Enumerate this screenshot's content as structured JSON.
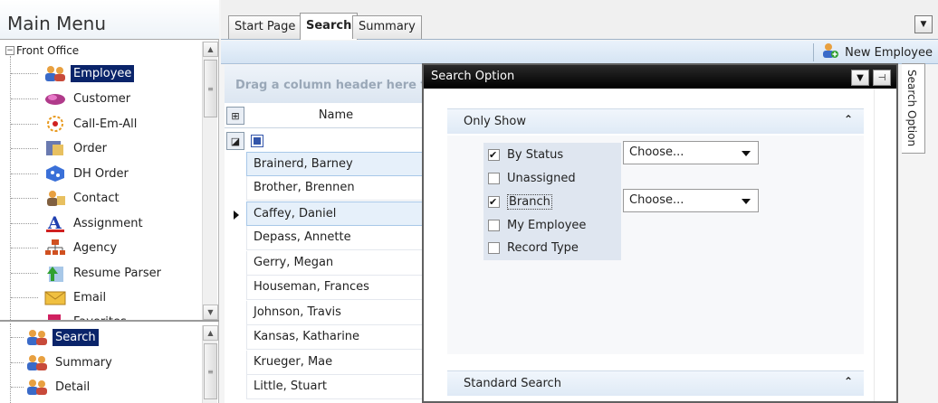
{
  "left_panel": {
    "title": "Main Menu",
    "root_label": "Front Office",
    "items": [
      {
        "label": "Employee",
        "icon": "employee-icon",
        "selected": true
      },
      {
        "label": "Customer",
        "icon": "customer-icon"
      },
      {
        "label": "Call-Em-All",
        "icon": "call-em-all-icon"
      },
      {
        "label": "Order",
        "icon": "order-icon"
      },
      {
        "label": "DH Order",
        "icon": "dh-order-icon"
      },
      {
        "label": "Contact",
        "icon": "contact-icon"
      },
      {
        "label": "Assignment",
        "icon": "assignment-icon"
      },
      {
        "label": "Agency",
        "icon": "agency-icon"
      },
      {
        "label": "Resume Parser",
        "icon": "resume-parser-icon"
      },
      {
        "label": "Email",
        "icon": "email-icon"
      },
      {
        "label": "Favorites",
        "icon": "favorites-icon"
      }
    ],
    "sub_items": [
      {
        "label": "Search",
        "icon": "employee-icon",
        "selected": true
      },
      {
        "label": "Summary",
        "icon": "employee-icon"
      },
      {
        "label": "Detail",
        "icon": "employee-icon"
      }
    ]
  },
  "tabs": [
    {
      "label": "Start Page",
      "active": false
    },
    {
      "label": "Search",
      "active": true
    },
    {
      "label": "Summary",
      "active": false
    }
  ],
  "toolbar": {
    "new_employee_label": "New Employee"
  },
  "grid": {
    "group_panel_text": "Drag a column header here t",
    "column_header": "Name",
    "rows": [
      "Brainerd, Barney",
      "Brother, Brennen",
      "Caffey, Daniel",
      "Depass, Annette",
      "Gerry, Megan",
      "Houseman, Frances",
      "Johnson, Travis",
      "Kansas, Katharine",
      "Krueger, Mae",
      "Little, Stuart"
    ],
    "highlighted_rows": [
      0,
      2
    ],
    "current_row": 2
  },
  "search_option": {
    "title": "Search Option",
    "only_show": {
      "header": "Only Show",
      "options": [
        {
          "label": "By Status",
          "checked": true
        },
        {
          "label": "Unassigned",
          "checked": false
        },
        {
          "label": "Branch",
          "checked": true
        },
        {
          "label": "My Employee",
          "checked": false
        },
        {
          "label": "Record Type",
          "checked": false
        }
      ],
      "status_combo": "Choose...",
      "branch_combo": "Choose..."
    },
    "standard_search": {
      "header": "Standard Search"
    }
  },
  "edge_tab": {
    "label": "Search Option"
  },
  "colors": {
    "selection": "#0a246a",
    "panel_title_bg": "#000000",
    "section_header": "#dfeaf6",
    "row_highlight": "#e6f0fa"
  }
}
